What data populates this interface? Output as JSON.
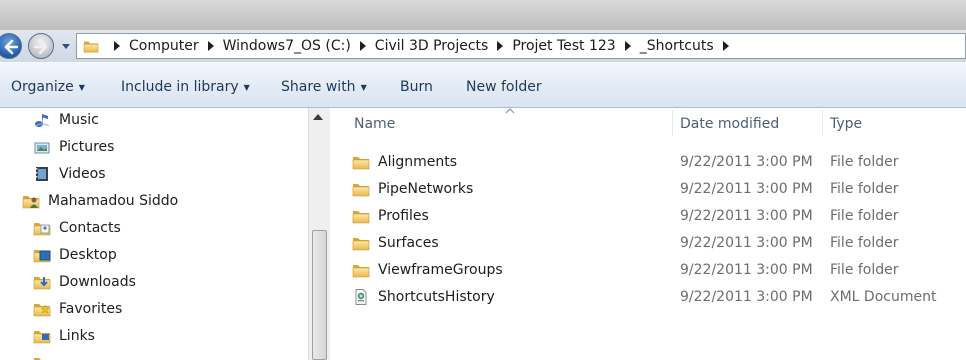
{
  "address": {
    "breadcrumbs": [
      "Computer",
      "Windows7_OS (C:)",
      "Civil 3D Projects",
      "Projet Test 123",
      "_Shortcuts"
    ]
  },
  "toolbar": {
    "organize_label": "Organize",
    "include_label": "Include in library",
    "share_label": "Share with",
    "burn_label": "Burn",
    "new_folder_label": "New folder"
  },
  "nav": {
    "items": [
      {
        "label": "Music",
        "icon": "music-icon"
      },
      {
        "label": "Pictures",
        "icon": "pictures-icon"
      },
      {
        "label": "Videos",
        "icon": "videos-icon"
      },
      {
        "label": "Mahamadou Siddo",
        "icon": "user-icon"
      },
      {
        "label": "Contacts",
        "icon": "contacts-icon"
      },
      {
        "label": "Desktop",
        "icon": "desktop-icon"
      },
      {
        "label": "Downloads",
        "icon": "downloads-icon"
      },
      {
        "label": "Favorites",
        "icon": "favorites-icon"
      },
      {
        "label": "Links",
        "icon": "links-icon"
      }
    ]
  },
  "columns": {
    "name": "Name",
    "date": "Date modified",
    "type": "Type"
  },
  "files": [
    {
      "name": "Alignments",
      "date": "9/22/2011 3:00 PM",
      "type": "File folder",
      "icon": "folder-icon"
    },
    {
      "name": "PipeNetworks",
      "date": "9/22/2011 3:00 PM",
      "type": "File folder",
      "icon": "folder-icon"
    },
    {
      "name": "Profiles",
      "date": "9/22/2011 3:00 PM",
      "type": "File folder",
      "icon": "folder-icon"
    },
    {
      "name": "Surfaces",
      "date": "9/22/2011 3:00 PM",
      "type": "File folder",
      "icon": "folder-icon"
    },
    {
      "name": "ViewframeGroups",
      "date": "9/22/2011 3:00 PM",
      "type": "File folder",
      "icon": "folder-icon"
    },
    {
      "name": "ShortcutsHistory",
      "date": "9/22/2011 3:00 PM",
      "type": "XML Document",
      "icon": "xml-file-icon"
    }
  ]
}
